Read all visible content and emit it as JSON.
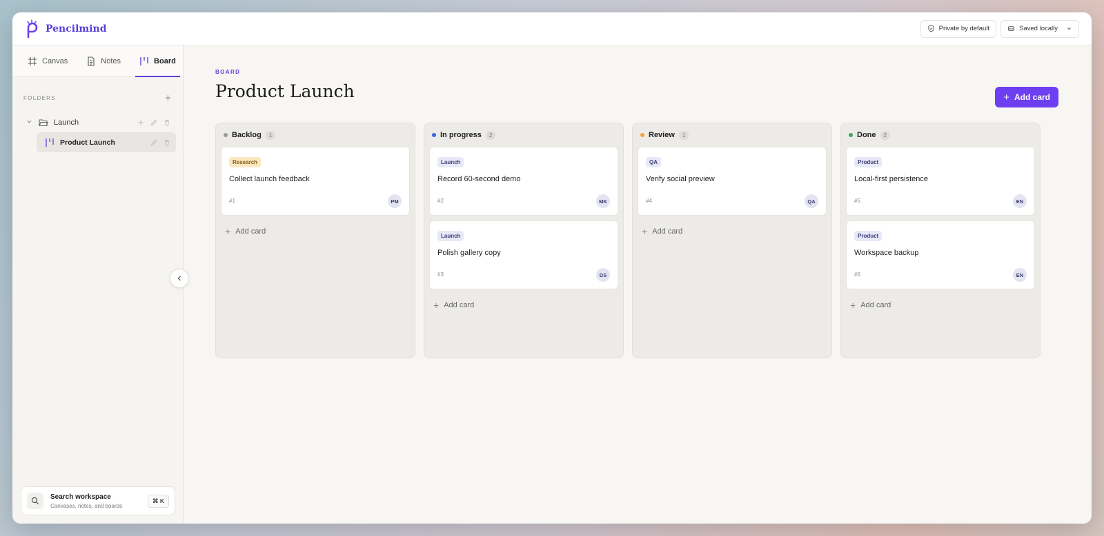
{
  "app": {
    "name": "Pencilmind"
  },
  "header": {
    "privacy_label": "Private by default",
    "save_status": "Saved locally"
  },
  "sidebar": {
    "tabs": [
      {
        "label": "Canvas",
        "icon": "hash-icon"
      },
      {
        "label": "Notes",
        "icon": "document-icon"
      },
      {
        "label": "Board",
        "icon": "board-icon",
        "active": true
      }
    ],
    "folders_heading": "FOLDERS",
    "tree": {
      "folder": "Launch",
      "child": "Product Launch"
    },
    "search": {
      "title": "Search workspace",
      "subtitle": "Canvases, notes, and boards",
      "shortcut": "⌘ K"
    }
  },
  "main": {
    "eyebrow": "BOARD",
    "title": "Product Launch",
    "add_card_label": "Add card",
    "column_add_label": "Add card"
  },
  "colors": {
    "accent": "#6d3ff0",
    "backlog": "#9a9a9a",
    "in_progress": "#3d63e8",
    "review": "#f0a23b",
    "done": "#3fa85f"
  },
  "columns": [
    {
      "title": "Backlog",
      "count": "1",
      "dot": "#9a9a9a",
      "cards": [
        {
          "tag": "Research",
          "tag_bg": "#fbe7c2",
          "tag_fg": "#8a5a10",
          "title": "Collect launch feedback",
          "num": "#1",
          "avatar": "PM"
        }
      ]
    },
    {
      "title": "In progress",
      "count": "2",
      "dot": "#3d63e8",
      "cards": [
        {
          "tag": "Launch",
          "tag_bg": "#e8e8f6",
          "tag_fg": "#3c3c78",
          "title": "Record 60-second demo",
          "num": "#2",
          "avatar": "MK"
        },
        {
          "tag": "Launch",
          "tag_bg": "#e8e8f6",
          "tag_fg": "#3c3c78",
          "title": "Polish gallery copy",
          "num": "#3",
          "avatar": "DS"
        }
      ]
    },
    {
      "title": "Review",
      "count": "1",
      "dot": "#f0a23b",
      "cards": [
        {
          "tag": "QA",
          "tag_bg": "#e8e8f6",
          "tag_fg": "#3c3c78",
          "title": "Verify social preview",
          "num": "#4",
          "avatar": "QA"
        }
      ]
    },
    {
      "title": "Done",
      "count": "2",
      "dot": "#3fa85f",
      "cards": [
        {
          "tag": "Product",
          "tag_bg": "#e8e8f6",
          "tag_fg": "#3c3c78",
          "title": "Local-first persistence",
          "num": "#5",
          "avatar": "EN"
        },
        {
          "tag": "Product",
          "tag_bg": "#e8e8f6",
          "tag_fg": "#3c3c78",
          "title": "Workspace backup",
          "num": "#6",
          "avatar": "EN"
        }
      ]
    }
  ]
}
